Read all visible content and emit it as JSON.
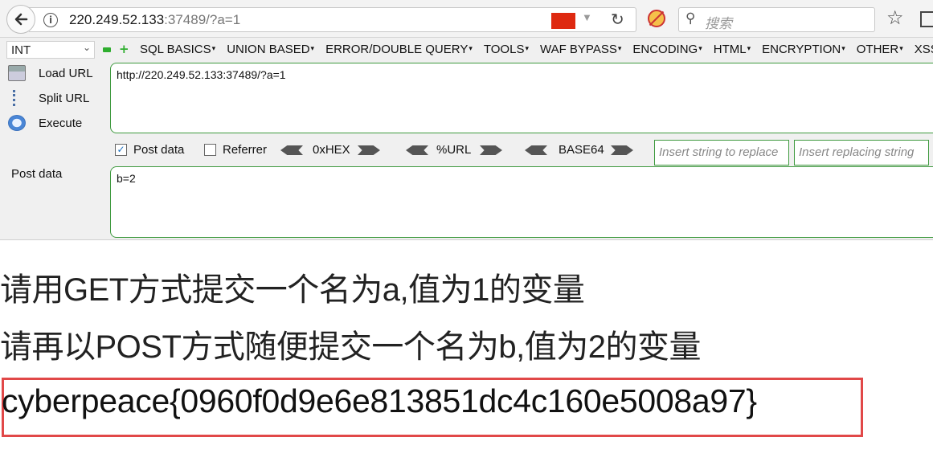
{
  "browser": {
    "url_host": "220.249.52.133",
    "url_rest": ":37489/?a=1",
    "search_placeholder": "搜索"
  },
  "hackbar": {
    "type_select": "INT",
    "menu": [
      "SQL BASICS",
      "UNION BASED",
      "ERROR/DOUBLE QUERY",
      "TOOLS",
      "WAF BYPASS",
      "ENCODING",
      "HTML",
      "ENCRYPTION",
      "OTHER",
      "XSS"
    ],
    "actions": {
      "load": "Load URL",
      "split": "Split URL",
      "execute": "Execute"
    },
    "url_value": "http://220.249.52.133:37489/?a=1",
    "post_data_checked": true,
    "post_data_label": "Post data",
    "referrer_label": "Referrer",
    "encoders": [
      "0xHEX",
      "%URL",
      "BASE64"
    ],
    "replace_placeholder": "Insert string to replace",
    "replacing_placeholder": "Insert replacing string",
    "post_section_label": "Post data",
    "post_value": "b=2"
  },
  "page": {
    "line1": "请用GET方式提交一个名为a,值为1的变量",
    "line2": "请再以POST方式随便提交一个名为b,值为2的变量",
    "flag": "cyberpeace{0960f0d9e6e813851dc4c160e5008a97}"
  },
  "colors": {
    "hackbar_border": "#3f9a3f",
    "flag_box": "#e14848"
  }
}
